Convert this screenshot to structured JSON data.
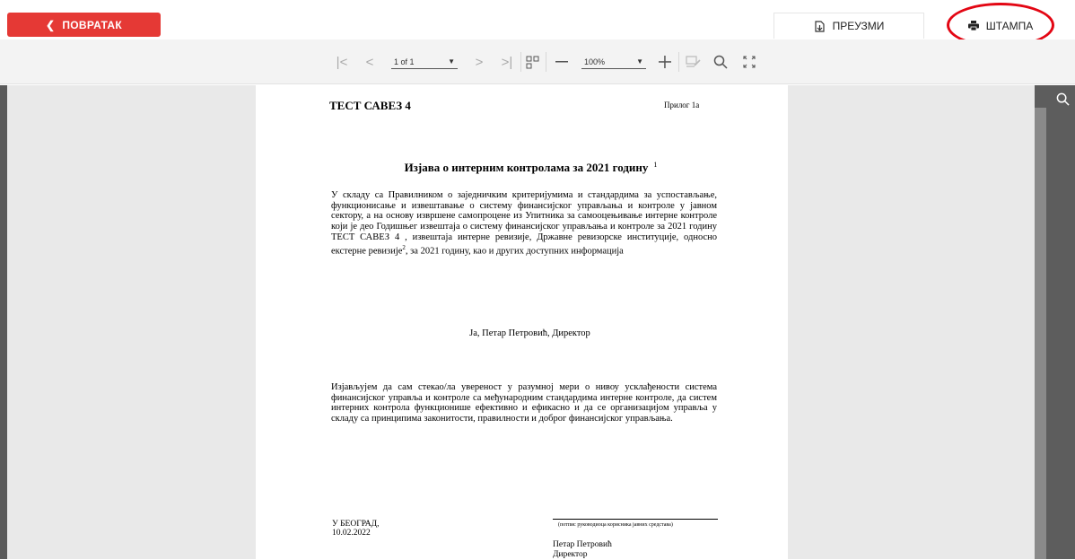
{
  "header": {
    "back_label": "ПОВРАТАК",
    "download_label": "ПРЕУЗМИ",
    "print_label": "ШТАМПА",
    "highlight_color": "#e30613",
    "back_color": "#e53935"
  },
  "toolbar": {
    "page_value": "1 of 1",
    "zoom_value": "100%",
    "icons": [
      "first-page-icon",
      "prev-page-icon",
      "next-page-icon",
      "last-page-icon",
      "multi-page-icon",
      "zoom-out-icon",
      "zoom-in-icon",
      "edit-form-icon",
      "search-icon",
      "fullscreen-icon"
    ]
  },
  "document": {
    "org": "ТЕСТ САВЕЗ 4",
    "attachment": "Прилог 1а",
    "title": "Изјава о интерним контролама за 2021 годину",
    "title_footnote": "1",
    "para1_a": "У складу са Правилником о заједничким критеријумима и стандардима за успостављање, функционисање и извештавање о систему финансијског управљања и контроле у јавном сектору, а на основу извршене самопроцене из Упитника за самооцењивање интерне контроле који је део Годишњег извештаја о систему финансијског управљања и контроле за 2021 годину ТЕСТ САВЕЗ 4 , извештаја интерне ревизије, Државне ревизорске институције, односно екстерне ревизије",
    "para1_sup": "2",
    "para1_b": ", за 2021 годину, као и других доступних информација",
    "signer": "Ја, Петар Петровић, Директор",
    "para2": "Изјављујем да сам стекао/ла увереност у разумној мери о нивоу усклађености система финансијског управља и контроле са међународним стандардима интерне контроле, да систем интерних контрола функционише ефективно и ефикасно и да се организацијом управља у складу са принципима законитости, правилности и доброг финансијског управљања.",
    "place": "У БЕОГРАД,",
    "date": "10.02.2022",
    "sig_caption": "(потпис руководиоца корисника јавних средстава)",
    "sig_name": "Петар Петровић",
    "sig_role": "Директор"
  }
}
